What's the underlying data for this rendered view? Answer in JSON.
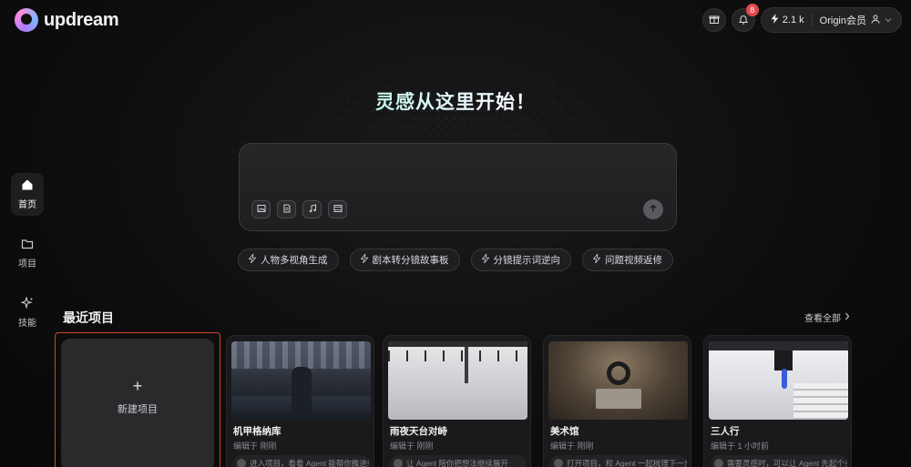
{
  "app": {
    "name": "updream"
  },
  "header": {
    "notifications_count": "8",
    "credits": "2.1 k",
    "membership": "Origin会员"
  },
  "sidebar": {
    "items": [
      {
        "label": "首页",
        "icon": "home-icon",
        "active": true
      },
      {
        "label": "项目",
        "icon": "folder-icon",
        "active": false
      },
      {
        "label": "技能",
        "icon": "sparkle-icon",
        "active": false
      }
    ]
  },
  "hero": {
    "title": "灵感从这里开始！"
  },
  "prompt": {
    "tools": [
      {
        "name": "image-upload-icon",
        "glyph": "▣"
      },
      {
        "name": "document-icon",
        "glyph": "▤"
      },
      {
        "name": "music-icon",
        "glyph": "♫"
      },
      {
        "name": "video-icon",
        "glyph": "▦"
      }
    ],
    "send_glyph": "↑"
  },
  "suggestions": [
    "人物多视角生成",
    "剧本转分镜故事板",
    "分镜提示词逆向",
    "问题视频返修"
  ],
  "recent": {
    "title": "最近项目",
    "see_all": "查看全部",
    "new_project": "新建项目",
    "projects": [
      {
        "name": "机甲格纳库",
        "meta": "编辑于 刚刚",
        "desc": "进入项目，看看 Agent 能帮你推进!"
      },
      {
        "name": "雨夜天台对峙",
        "meta": "编辑于 刚刚",
        "desc": "让 Agent 陪你把想法继续展开"
      },
      {
        "name": "美术馆",
        "meta": "编辑于 刚刚",
        "desc": "打开项目，和 Agent 一起梳理下一步"
      },
      {
        "name": "三人行",
        "meta": "编辑于 1 小时前",
        "desc": "需要灵感时，可以让 Agent 先起个头"
      }
    ]
  },
  "colors": {
    "accent_red": "#d2432d",
    "badge_red": "#e5484d",
    "background": "#0e0e0f"
  }
}
